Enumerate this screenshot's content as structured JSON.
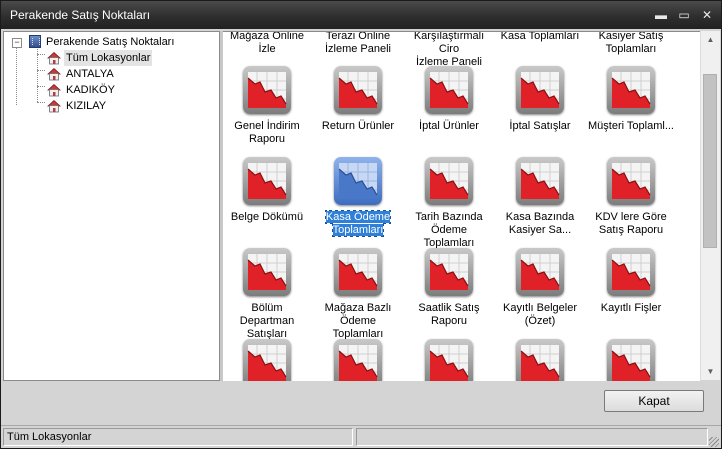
{
  "window": {
    "title": "Perakende Satış Noktaları"
  },
  "titlebar_buttons": {
    "minimize": "▬",
    "maximize": "▭",
    "close": "✕"
  },
  "tree": {
    "root": "Perakende Satış Noktaları",
    "items": [
      {
        "label": "Tüm Lokasyonlar",
        "selected": true
      },
      {
        "label": "ANTALYA"
      },
      {
        "label": "KADIKÖY"
      },
      {
        "label": "KIZILAY"
      }
    ],
    "expander": "−"
  },
  "reports": {
    "partial_top": [
      "Mağaza Online\nİzle",
      "Terazi Online\nİzleme Paneli",
      "Karşılaştırmalı Ciro\nİzleme Paneli",
      "Kasa Toplamları",
      "Kasiyer Satış\nToplamları"
    ],
    "row1": [
      "Genel İndirim\nRaporu",
      "Return Ürünler",
      "İptal Ürünler",
      "İptal Satışlar",
      "Müşteri Toplaml..."
    ],
    "row2": [
      "Belge Dökümü",
      "Kasa Ödeme\nToplamları",
      "Tarih Bazında\nÖdeme Toplamları",
      "Kasa Bazında\nKasiyer Sa...",
      "KDV lere Göre\nSatış Raporu"
    ],
    "row3": [
      "Bölüm Departman\nSatışları",
      "Mağaza Bazlı\nÖdeme Toplamları",
      "Saatlik Satış\nRaporu",
      "Kayıtlı Belgeler\n(Özet)",
      "Kayıtlı Fişler"
    ],
    "selected_report": "Kasa Ödeme\nToplamları",
    "icon_name": "red-chart-report-icon"
  },
  "buttons": {
    "close_label": "Kapat"
  },
  "status": {
    "location": "Tüm Lokasyonlar",
    "secondary": ""
  },
  "scrollbar": {
    "up": "▲",
    "down": "▼"
  },
  "colors": {
    "accent": "#2f80d8",
    "icon_red": "#e0222a",
    "titlebar": "#333333"
  }
}
